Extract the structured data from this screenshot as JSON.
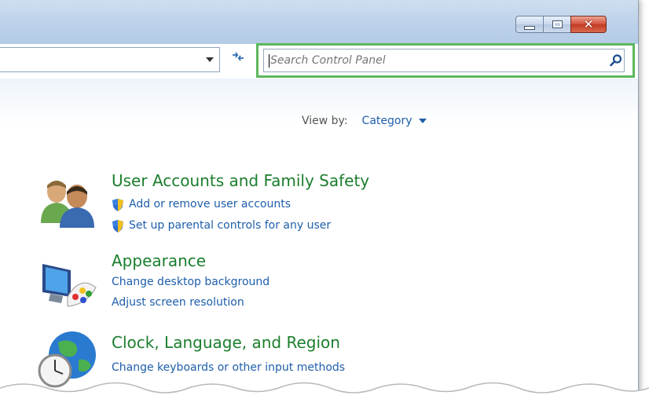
{
  "window": {
    "controls": {
      "minimize": "minimize",
      "maximize": "maximize",
      "close": "✕"
    }
  },
  "address": {
    "value": ""
  },
  "search": {
    "placeholder": "Search Control Panel",
    "value": ""
  },
  "view_by": {
    "label": "View by:",
    "value": "Category"
  },
  "categories": [
    {
      "title": "User Accounts and Family Safety",
      "icon": "users-icon",
      "links": [
        "Add or remove user accounts",
        "Set up parental controls for any user"
      ]
    },
    {
      "title": "Appearance",
      "icon": "monitor-palette-icon",
      "links": [
        "Change desktop background",
        "Adjust screen resolution"
      ]
    },
    {
      "title": "Clock, Language, and Region",
      "icon": "globe-clock-icon",
      "links": [
        "Change keyboards or other input methods"
      ]
    }
  ],
  "colors": {
    "category_title": "#1b7e2d",
    "link": "#1e5eaa",
    "search_highlight": "#5cb85c",
    "titlebar": "#c4d7ed",
    "close_button": "#c94a33"
  }
}
